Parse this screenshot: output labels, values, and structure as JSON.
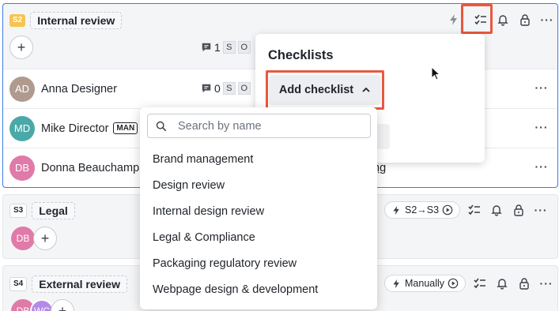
{
  "stages": {
    "s2": {
      "badge": "S2",
      "name": "Internal review",
      "comment_count": "1",
      "box_a": "S",
      "box_b": "O"
    },
    "s3": {
      "badge": "S3",
      "name": "Legal",
      "trigger": "S2→S3"
    },
    "s4": {
      "badge": "S4",
      "name": "External review",
      "trigger": "Manually"
    }
  },
  "members": [
    {
      "initials": "AD",
      "name": "Anna Designer",
      "color": "#b09a8e",
      "comment_count": "0",
      "box_a": "S",
      "box_b": "O"
    },
    {
      "initials": "MD",
      "name": "Mike Director",
      "role": "MAN",
      "color": "#4aa9a8"
    },
    {
      "initials": "DB",
      "name": "Donna Beauchamp",
      "color": "#e07aa8",
      "trailing_text": "ng"
    }
  ],
  "s3_avatar": {
    "initials": "DB",
    "color": "#e07aa8"
  },
  "s4_avatars": [
    {
      "initials": "DB",
      "color": "#e07aa8"
    },
    {
      "initials": "WC",
      "color": "#b48ae6"
    }
  ],
  "popover": {
    "title": "Checklists",
    "add_label": "Add checklist"
  },
  "search": {
    "placeholder": "Search by name",
    "value": ""
  },
  "options": [
    "Brand management",
    "Design review",
    "Internal design review",
    "Legal & Compliance",
    "Packaging regulatory review",
    "Webpage design & development"
  ],
  "icons": {
    "bolt": "bolt-icon",
    "checklist": "checklist-icon",
    "bell": "bell-icon",
    "lock": "lock-icon",
    "more": "more-icon",
    "comment": "comment-icon",
    "play": "play-circle-icon",
    "search": "search-icon",
    "chevron": "chevron-up-icon",
    "plus": "plus-icon"
  },
  "colors": {
    "accent": "#3d7be8",
    "highlight": "#e8583f",
    "stage_yellow": "#f6c44f"
  }
}
